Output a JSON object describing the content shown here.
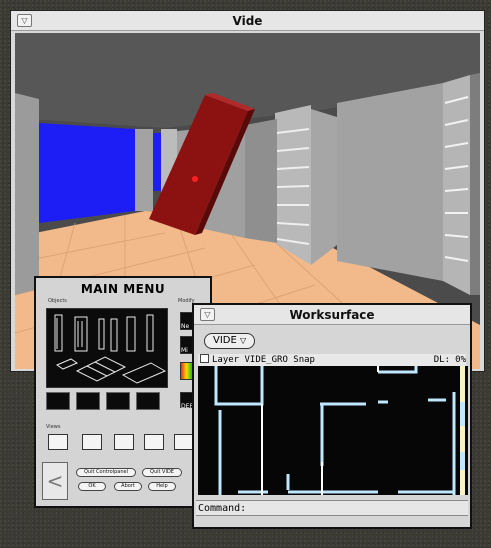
{
  "vide_window": {
    "title": "Vide",
    "menu_glyph": "▽"
  },
  "main_menu": {
    "title": "MAIN MENU",
    "section_objects": "Objects",
    "section_modify": "Modify",
    "section_views": "Views",
    "side_labels": [
      "Ne",
      "Mi",
      "DEF"
    ],
    "buttons": {
      "quit_controlpanel": "Quit Controlpanel",
      "quit_vide": "Quit VIDE",
      "ok": "OK",
      "abort": "Abort",
      "help": "Help"
    }
  },
  "worksurface": {
    "title": "Worksurface",
    "menu_glyph": "▽",
    "dropdown_label": "VIDE",
    "dropdown_glyph": "▽",
    "layer_label": "Layer VIDE_GRO Snap",
    "dl_label": "DL:",
    "dl_value": "0%",
    "command_label": "Command:",
    "command_value": ""
  },
  "colors": {
    "desktop": "#3b3b34",
    "wall": "#a9a9a9",
    "floor": "#f2b98a",
    "sky": "#5a5a5a",
    "blue_opening": "#1d1df5",
    "door_red": "#8c1212",
    "cad_line": "#bfe8ff"
  }
}
